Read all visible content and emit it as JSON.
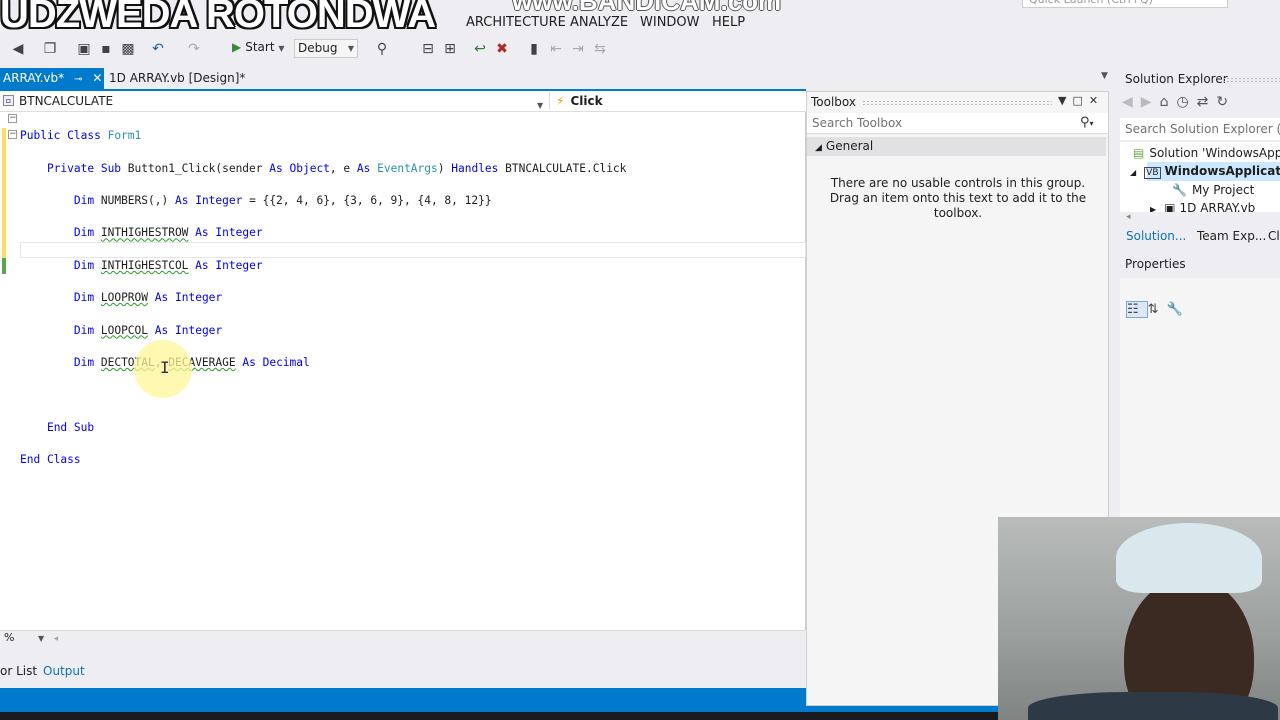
{
  "overlay": {
    "name": "UDZWEDA ROTONDWA",
    "watermark": "www.BANDICAM.com"
  },
  "menu": {
    "items": [
      "ARCHITECTURE",
      "ANALYZE",
      "WINDOW",
      "HELP"
    ],
    "quick_launch_placeholder": "Quick Launch (Ctrl+Q)"
  },
  "toolbar": {
    "start_label": "Start",
    "config_label": "Debug"
  },
  "tabs": {
    "active": "ARRAY.vb*",
    "design": "1D ARRAY.vb [Design]*"
  },
  "editor": {
    "nav_left": "BTNCALCULATE",
    "nav_right": "Click",
    "zoom": "%",
    "code": {
      "l1_kw": "Public Class",
      "l1_name": "Form1",
      "l2_kw1": "Private Sub",
      "l2_a": "Button1_Click(sender",
      "l2_as1": "As",
      "l2_obj": "Object",
      "l2_b": ", e",
      "l2_as2": "As",
      "l2_evt": "EventArgs",
      "l2_c": ")",
      "l2_handles": "Handles",
      "l2_d": "BTNCALCULATE.Click",
      "l3_dim": "Dim",
      "l3_a": "NUMBERS(,)",
      "l3_as": "As",
      "l3_type": "Integer",
      "l3_b": "= {{2, 4, 6}, {3, 6, 9}, {4, 8, 12}}",
      "l4_dim": "Dim",
      "l4_var": "INTHIGHESTROW",
      "l4_as": "As",
      "l4_type": "Integer",
      "l5_dim": "Dim",
      "l5_var": "INTHIGHESTCOL",
      "l5_as": "As",
      "l5_type": "Integer",
      "l6_dim": "Dim",
      "l6_var": "LOOPROW",
      "l6_as": "As",
      "l6_type": "Integer",
      "l7_dim": "Dim",
      "l7_var": "LOOPCOL",
      "l7_as": "As",
      "l7_type": "Integer",
      "l8_dim": "Dim",
      "l8_var1": "DECTOTAL",
      "l8_sep": ",",
      "l8_var2": "DECAVERAGE",
      "l8_as": "As",
      "l8_type": "Decimal",
      "l10": "End Sub",
      "l11": "End Class"
    }
  },
  "bottom_panel": {
    "error_list": "or List",
    "output": "Output"
  },
  "toolbox": {
    "title": "Toolbox",
    "search_placeholder": "Search Toolbox",
    "group": "General",
    "empty_message": "There are no usable controls in this group. Drag an item onto this text to add it to the toolbox."
  },
  "solution_explorer": {
    "title": "Solution Explorer",
    "search_placeholder": "Search Solution Explorer (Ctrl",
    "tree": [
      "Solution 'WindowsAppl",
      "WindowsApplicatio",
      "My Project",
      "1D ARRAY.vb"
    ],
    "tabs": [
      "Solution...",
      "Team Exp...",
      "Cl"
    ]
  },
  "properties": {
    "title": "Properties"
  },
  "colors": {
    "accent": "#007acc",
    "keyword": "#0000ff",
    "type": "#2b91af"
  }
}
